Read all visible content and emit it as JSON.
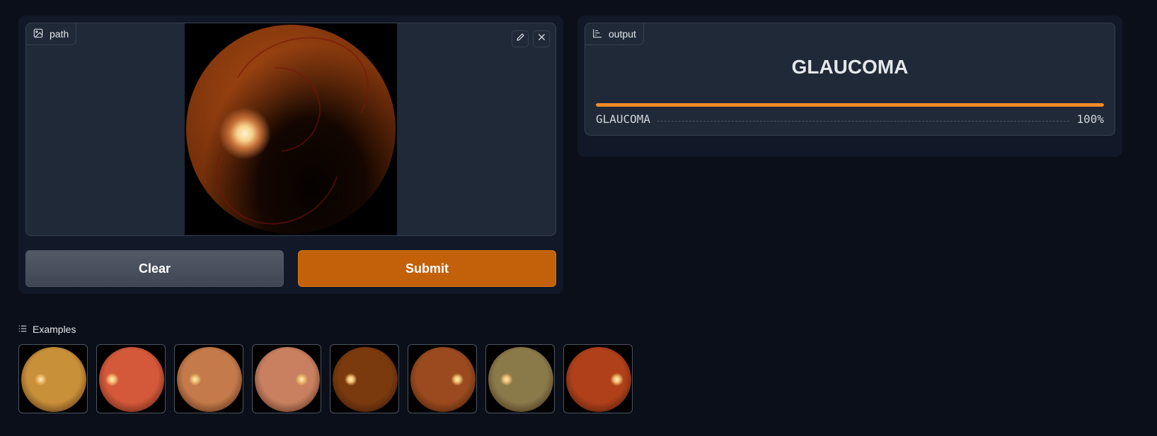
{
  "input": {
    "label": "path",
    "label_icon": "image-icon",
    "edit_icon": "pencil-icon",
    "clear_icon": "close-icon"
  },
  "buttons": {
    "clear_label": "Clear",
    "submit_label": "Submit"
  },
  "output": {
    "label": "output",
    "label_icon": "bar-chart-icon",
    "prediction": "GLAUCOMA",
    "confidences": [
      {
        "label": "GLAUCOMA",
        "value": "100%",
        "fraction": 1.0
      }
    ]
  },
  "examples": {
    "title": "Examples",
    "title_icon": "list-icon",
    "items": [
      {
        "name": "example-1",
        "tint": "#c9903a"
      },
      {
        "name": "example-2",
        "tint": "#d4583a"
      },
      {
        "name": "example-3",
        "tint": "#c47a4a"
      },
      {
        "name": "example-4",
        "tint": "#c88060"
      },
      {
        "name": "example-5",
        "tint": "#7a3a0e"
      },
      {
        "name": "example-6",
        "tint": "#9a4a1e"
      },
      {
        "name": "example-7",
        "tint": "#8a7a4a"
      },
      {
        "name": "example-8",
        "tint": "#b0401a"
      }
    ]
  },
  "colors": {
    "accent": "#c2610a",
    "bar": "#f28b28",
    "background": "#0b0f19"
  }
}
